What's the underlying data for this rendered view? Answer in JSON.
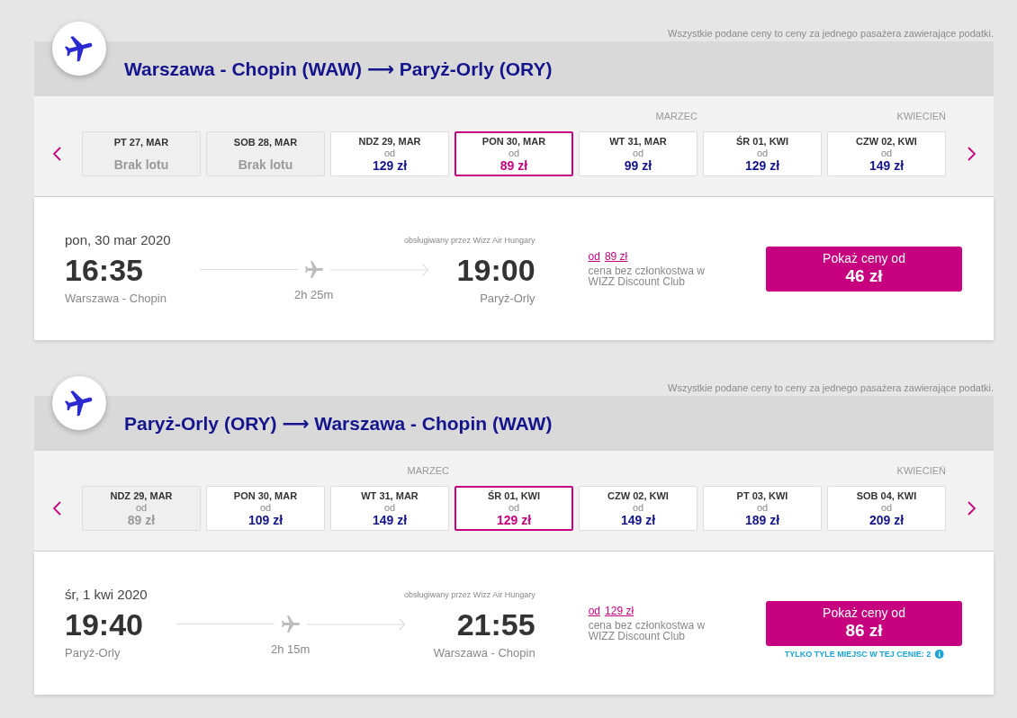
{
  "journeys": [
    {
      "disclaimer": "Wszystkie podane ceny to ceny za jednego pasażera zawierające podatki.",
      "title": "Warszawa - Chopin (WAW) ⟶ Paryż-Orly (ORY)",
      "dates": [
        {
          "label": "PT 27, MAR",
          "kind": "no_flight",
          "note": "Brak lotu",
          "selected": false,
          "disabled": true
        },
        {
          "label": "SOB 28, MAR",
          "kind": "no_flight",
          "note": "Brak lotu",
          "selected": false,
          "disabled": true
        },
        {
          "label": "NDZ 29, MAR",
          "kind": "fare",
          "from": "od",
          "price": "129 zł",
          "selected": false,
          "disabled": false
        },
        {
          "label": "PON 30, MAR",
          "kind": "fare",
          "from": "od",
          "price": "89 zł",
          "selected": true,
          "disabled": false
        },
        {
          "label": "WT 31, MAR",
          "kind": "fare",
          "from": "od",
          "price": "99 zł",
          "month": "MARZEC",
          "selected": false,
          "disabled": false
        },
        {
          "label": "ŚR 01, KWI",
          "kind": "fare",
          "from": "od",
          "price": "129 zł",
          "selected": false,
          "disabled": false
        },
        {
          "label": "CZW 02, KWI",
          "kind": "fare",
          "from": "od",
          "price": "149 zł",
          "month": "KWIECIEŃ",
          "selected": false,
          "disabled": false
        }
      ],
      "flight": {
        "date": "pon, 30 mar 2020",
        "departure_time": "16:35",
        "departure_city": "Warszawa - Chopin",
        "duration": "2h 25m",
        "operator": "obsługiwany przez Wizz Air Hungary",
        "arrival_time": "19:00",
        "arrival_city": "Paryż-Orly",
        "fare_prefix": "od",
        "fare_link": "89 zł",
        "fare_note": "cena bez członkostwa w WIZZ Discount Club",
        "button_label": "Pokaż ceny od",
        "button_price": "46 zł"
      }
    },
    {
      "disclaimer": "Wszystkie podane ceny to ceny za jednego pasażera zawierające podatki.",
      "title": "Paryż-Orly (ORY) ⟶ Warszawa - Chopin (WAW)",
      "dates": [
        {
          "label": "NDZ 29, MAR",
          "kind": "fare",
          "from": "od",
          "price": "89 zł",
          "selected": false,
          "disabled": true
        },
        {
          "label": "PON 30, MAR",
          "kind": "fare",
          "from": "od",
          "price": "109 zł",
          "selected": false,
          "disabled": false
        },
        {
          "label": "WT 31, MAR",
          "kind": "fare",
          "from": "od",
          "price": "149 zł",
          "month": "MARZEC",
          "selected": false,
          "disabled": false
        },
        {
          "label": "ŚR 01, KWI",
          "kind": "fare",
          "from": "od",
          "price": "129 zł",
          "selected": true,
          "disabled": false
        },
        {
          "label": "CZW 02, KWI",
          "kind": "fare",
          "from": "od",
          "price": "149 zł",
          "selected": false,
          "disabled": false
        },
        {
          "label": "PT 03, KWI",
          "kind": "fare",
          "from": "od",
          "price": "189 zł",
          "selected": false,
          "disabled": false
        },
        {
          "label": "SOB 04, KWI",
          "kind": "fare",
          "from": "od",
          "price": "209 zł",
          "month": "KWIECIEŃ",
          "selected": false,
          "disabled": false
        }
      ],
      "flight": {
        "date": "śr, 1 kwi 2020",
        "departure_time": "19:40",
        "departure_city": "Paryż-Orly",
        "duration": "2h 15m",
        "operator": "obsługiwany przez Wizz Air Hungary",
        "arrival_time": "21:55",
        "arrival_city": "Warszawa - Chopin",
        "fare_prefix": "od",
        "fare_link": "129 zł",
        "fare_note": "cena bez członkostwa w WIZZ Discount Club",
        "button_label": "Pokaż ceny od",
        "button_price": "86 zł",
        "seats_notice": "TYLKO TYLE MIEJSC W TEJ CENIE: 2"
      }
    }
  ]
}
